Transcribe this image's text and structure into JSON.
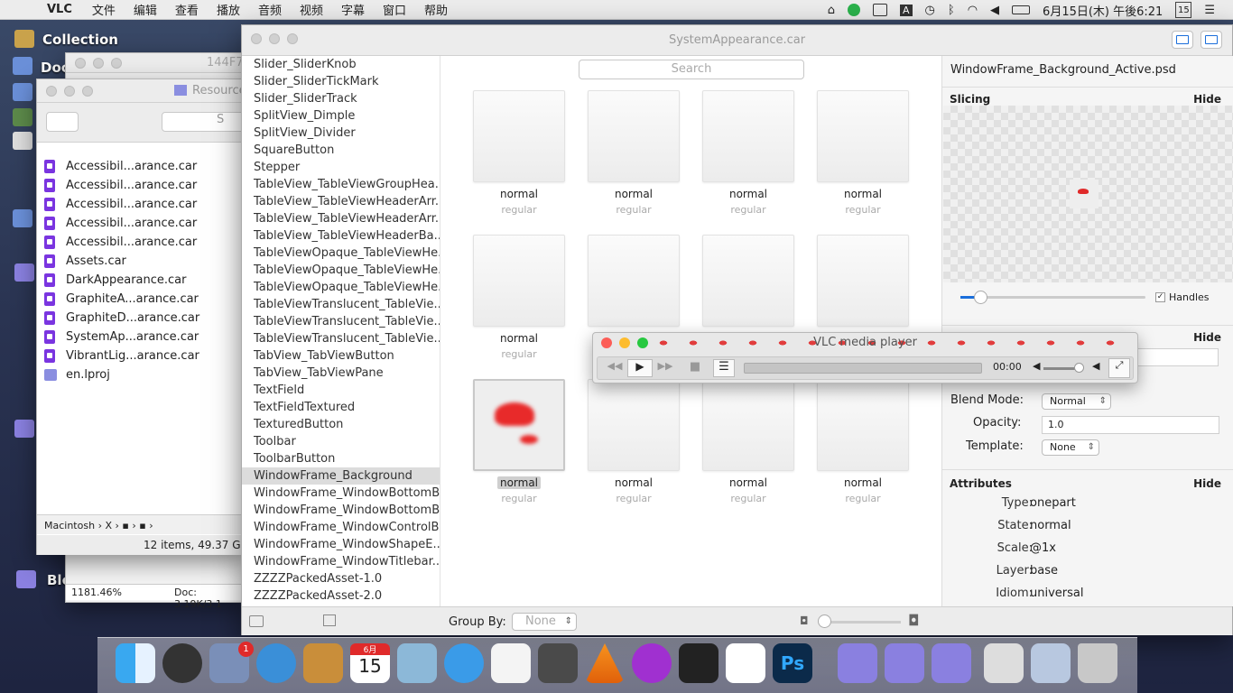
{
  "menubar": {
    "app": "VLC",
    "items": [
      "文件",
      "编辑",
      "查看",
      "播放",
      "音频",
      "视频",
      "字幕",
      "窗口",
      "帮助"
    ],
    "clock": "6月15日(木) 午後6:21",
    "calendar_day": "15"
  },
  "desktop": {
    "labels": [
      "Collection",
      "Doc",
      "Ble"
    ]
  },
  "finder": {
    "title": "Resource",
    "title2": "144F7",
    "search_hint": "S",
    "files": [
      "Accessibil...arance.car",
      "Accessibil...arance.car",
      "Accessibil...arance.car",
      "Accessibil...arance.car",
      "Accessibil...arance.car",
      "Assets.car",
      "DarkAppearance.car",
      "GraphiteA...arance.car",
      "GraphiteD...arance.car",
      "SystemAp...arance.car",
      "VibrantLig...arance.car",
      "en.lproj"
    ],
    "path": [
      "Macintosh",
      "›",
      "X",
      "›",
      "›",
      "›"
    ],
    "status": "12 items, 49.37 GB a",
    "zoom": "1181.46%",
    "doc": "Doc: 3.19K/3.1"
  },
  "main": {
    "title": "SystemAppearance.car",
    "search_placeholder": "Search",
    "list": [
      "Slider_SliderKnob",
      "Slider_SliderTickMark",
      "Slider_SliderTrack",
      "SplitView_Dimple",
      "SplitView_Divider",
      "SquareButton",
      "Stepper",
      "TableView_TableViewGroupHea...",
      "TableView_TableViewHeaderArr...",
      "TableView_TableViewHeaderArr...",
      "TableView_TableViewHeaderBa...",
      "TableViewOpaque_TableViewHe...",
      "TableViewOpaque_TableViewHe...",
      "TableViewOpaque_TableViewHe...",
      "TableViewTranslucent_TableVie...",
      "TableViewTranslucent_TableVie...",
      "TableViewTranslucent_TableVie...",
      "TabView_TabViewButton",
      "TabView_TabViewPane",
      "TextField",
      "TextFieldTextured",
      "TexturedButton",
      "Toolbar",
      "ToolbarButton",
      "WindowFrame_Background",
      "WindowFrame_WindowBottomB...",
      "WindowFrame_WindowBottomB...",
      "WindowFrame_WindowControlB...",
      "WindowFrame_WindowShapeE...",
      "WindowFrame_WindowTitlebar...",
      "ZZZZPackedAsset-1.0",
      "ZZZZPackedAsset-2.0"
    ],
    "selected_index": 24,
    "cells": [
      {
        "n": "normal",
        "s": "regular"
      },
      {
        "n": "normal",
        "s": "regular"
      },
      {
        "n": "normal",
        "s": "regular"
      },
      {
        "n": "normal",
        "s": "regular"
      },
      {
        "n": "normal",
        "s": "regular"
      },
      {
        "n": "normal",
        "s": "regular"
      },
      {
        "n": "normal",
        "s": "regular"
      },
      {
        "n": "normal",
        "s": "regular"
      },
      {
        "n": "normal",
        "s": "regular"
      },
      {
        "n": "normal",
        "s": "regular"
      },
      {
        "n": "normal",
        "s": "regular"
      },
      {
        "n": "normal",
        "s": "regular"
      }
    ],
    "group_by_label": "Group By:",
    "group_by_value": "None"
  },
  "inspector": {
    "filename": "WindowFrame_Background_Active.psd",
    "slicing": "Slicing",
    "hide": "Hide",
    "handles": "Handles",
    "blend_label": "Blend Mode:",
    "blend_value": "Normal",
    "opacity_label": "Opacity:",
    "opacity_value": "1.0",
    "template_label": "Template:",
    "template_value": "None",
    "attributes": "Attributes",
    "attrs": [
      {
        "k": "Type:",
        "v": "onepart"
      },
      {
        "k": "State:",
        "v": "normal"
      },
      {
        "k": "Scale:",
        "v": "@1x"
      },
      {
        "k": "Layer:",
        "v": "base"
      },
      {
        "k": "Idiom:",
        "v": "universal"
      }
    ]
  },
  "vlc": {
    "title": "VLC media player",
    "time": "00:00",
    "volume": 0.8
  },
  "dock": {
    "badge": "1",
    "cal_month": "6月",
    "cal_day": "15"
  },
  "colors": {
    "accent": "#1a6edb",
    "purple": "#7a35e0",
    "red": "#e02a2a"
  }
}
